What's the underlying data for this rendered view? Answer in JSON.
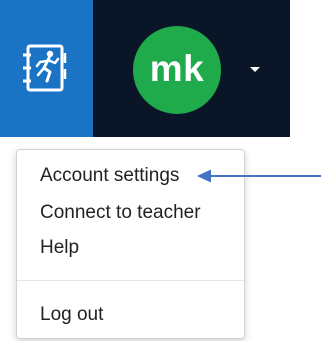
{
  "header": {
    "logo_icon": "running-figure-book-icon",
    "avatar_initials": "mk",
    "avatar_color": "#1faa4b",
    "caret_icon": "caret-down-icon",
    "background_color": "#0a1628",
    "logo_background_color": "#1a73c4"
  },
  "menu": {
    "items": [
      {
        "label": "Account settings"
      },
      {
        "label": "Connect to teacher"
      },
      {
        "label": "Help"
      }
    ],
    "logout_label": "Log out"
  },
  "annotation": {
    "arrow_icon": "pointer-arrow-icon",
    "arrow_color": "#4472c4"
  }
}
